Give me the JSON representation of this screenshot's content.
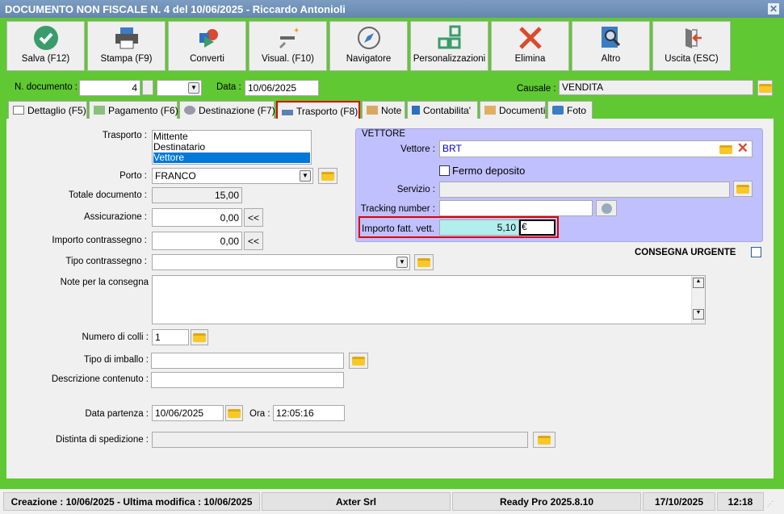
{
  "window": {
    "title": "DOCUMENTO NON FISCALE N. 4 del 10/06/2025 - Riccardo Antonioli"
  },
  "toolbar": [
    {
      "label": "Salva (F12)",
      "icon": "check-circle-icon"
    },
    {
      "label": "Stampa (F9)",
      "icon": "printer-icon"
    },
    {
      "label": "Converti",
      "icon": "convert-icon"
    },
    {
      "label": "Visual. (F10)",
      "icon": "magic-wand-icon"
    },
    {
      "label": "Navigatore",
      "icon": "compass-icon"
    },
    {
      "label": "Personalizzazioni",
      "icon": "grid-icon"
    },
    {
      "label": "Elimina",
      "icon": "x-icon"
    },
    {
      "label": "Altro",
      "icon": "search-book-icon"
    },
    {
      "label": "Uscita (ESC)",
      "icon": "exit-door-icon"
    }
  ],
  "header": {
    "n_documento_label": "N. documento :",
    "n_documento": "4",
    "data_label": "Data :",
    "data": "10/06/2025",
    "causale_label": "Causale :",
    "causale": "VENDITA"
  },
  "tabs": [
    {
      "label": "Dettaglio (F5)"
    },
    {
      "label": "Pagamento (F6)"
    },
    {
      "label": "Destinazione (F7)"
    },
    {
      "label": "Trasporto (F8)",
      "active": true
    },
    {
      "label": "Note"
    },
    {
      "label": "Contabilita'"
    },
    {
      "label": "Documenti"
    },
    {
      "label": "Foto"
    }
  ],
  "form": {
    "trasporto_label": "Trasporto :",
    "trasporto_options": [
      "Mittente",
      "Destinatario",
      "Vettore"
    ],
    "trasporto_selected": "Vettore",
    "porto_label": "Porto :",
    "porto": "FRANCO",
    "totale_label": "Totale documento :",
    "totale": "15,00",
    "assicurazione_label": "Assicurazione :",
    "assicurazione": "0,00",
    "contrassegno_label": "Importo contrassegno :",
    "contrassegno": "0,00",
    "back_label": "<<",
    "tipo_contrassegno_label": "Tipo contrassegno :",
    "note_label": "Note per la consegna",
    "colli_label": "Numero di colli :",
    "colli": "1",
    "imballo_label": "Tipo di imballo :",
    "descrizione_label": "Descrizione contenuto :",
    "data_partenza_label": "Data partenza :",
    "data_partenza": "10/06/2025",
    "ora_label": "Ora :",
    "ora": "12:05:16",
    "distinta_label": "Distinta di spedizione :"
  },
  "vettore": {
    "group_title": "VETTORE",
    "vettore_label": "Vettore :",
    "vettore": "BRT",
    "fermo_label": "Fermo deposito",
    "servizio_label": "Servizio :",
    "tracking_label": "Tracking number :",
    "importo_label": "Importo fatt. vett.",
    "importo": "5,10",
    "currency": "€"
  },
  "urgente_label": "CONSEGNA URGENTE",
  "status": {
    "creazione": "Creazione : 10/06/2025 - Ultima modifica : 10/06/2025",
    "company": "Axter Srl",
    "version": "Ready Pro 2025.8.10",
    "date": "17/10/2025",
    "time": "12:18"
  },
  "colors": {
    "green": "#5fc832",
    "accent_red": "#e00000",
    "vettore_bg": "#c0c0ff",
    "selected": "#0078d7"
  }
}
